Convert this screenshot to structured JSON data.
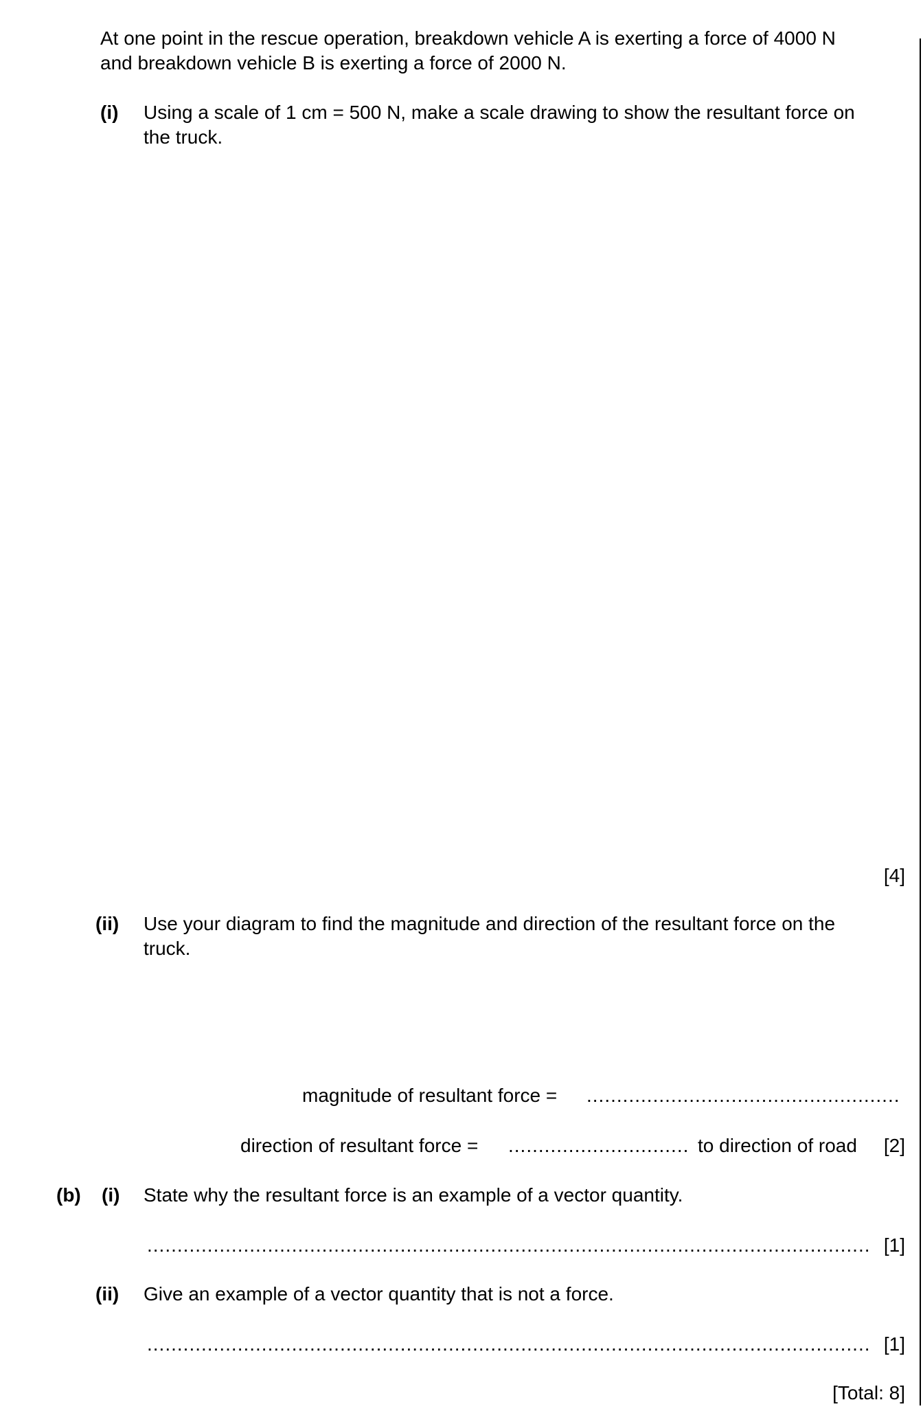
{
  "intro": {
    "line1": "At one point in the rescue operation, breakdown vehicle A is exerting a force of 4000 N",
    "line2": "and breakdown vehicle B is exerting a force of 2000 N."
  },
  "part_a_i": {
    "label": "(i)",
    "line1": "Using a scale of 1 cm = 500 N, make a scale drawing to show the resultant force on",
    "line2": "the truck.",
    "marks": "[4]"
  },
  "part_a_ii": {
    "label": "(ii)",
    "line1": "Use your diagram to find the magnitude and direction of the resultant force on the",
    "line2": "truck.",
    "magnitude_label": "magnitude of resultant force =",
    "magnitude_answer": "",
    "direction_label": "direction of resultant force =",
    "direction_answer": "",
    "direction_suffix": "to direction of road",
    "marks": "[2]"
  },
  "part_b_i": {
    "part_label": "(b)",
    "label": "(i)",
    "question": "State why the resultant force is an example of a vector quantity.",
    "answer": "",
    "marks": "[1]"
  },
  "part_b_ii": {
    "label": "(ii)",
    "question": "Give an example of a vector quantity that is not a force.",
    "answer": "",
    "marks": "[1]"
  },
  "total": "[Total: 8]"
}
